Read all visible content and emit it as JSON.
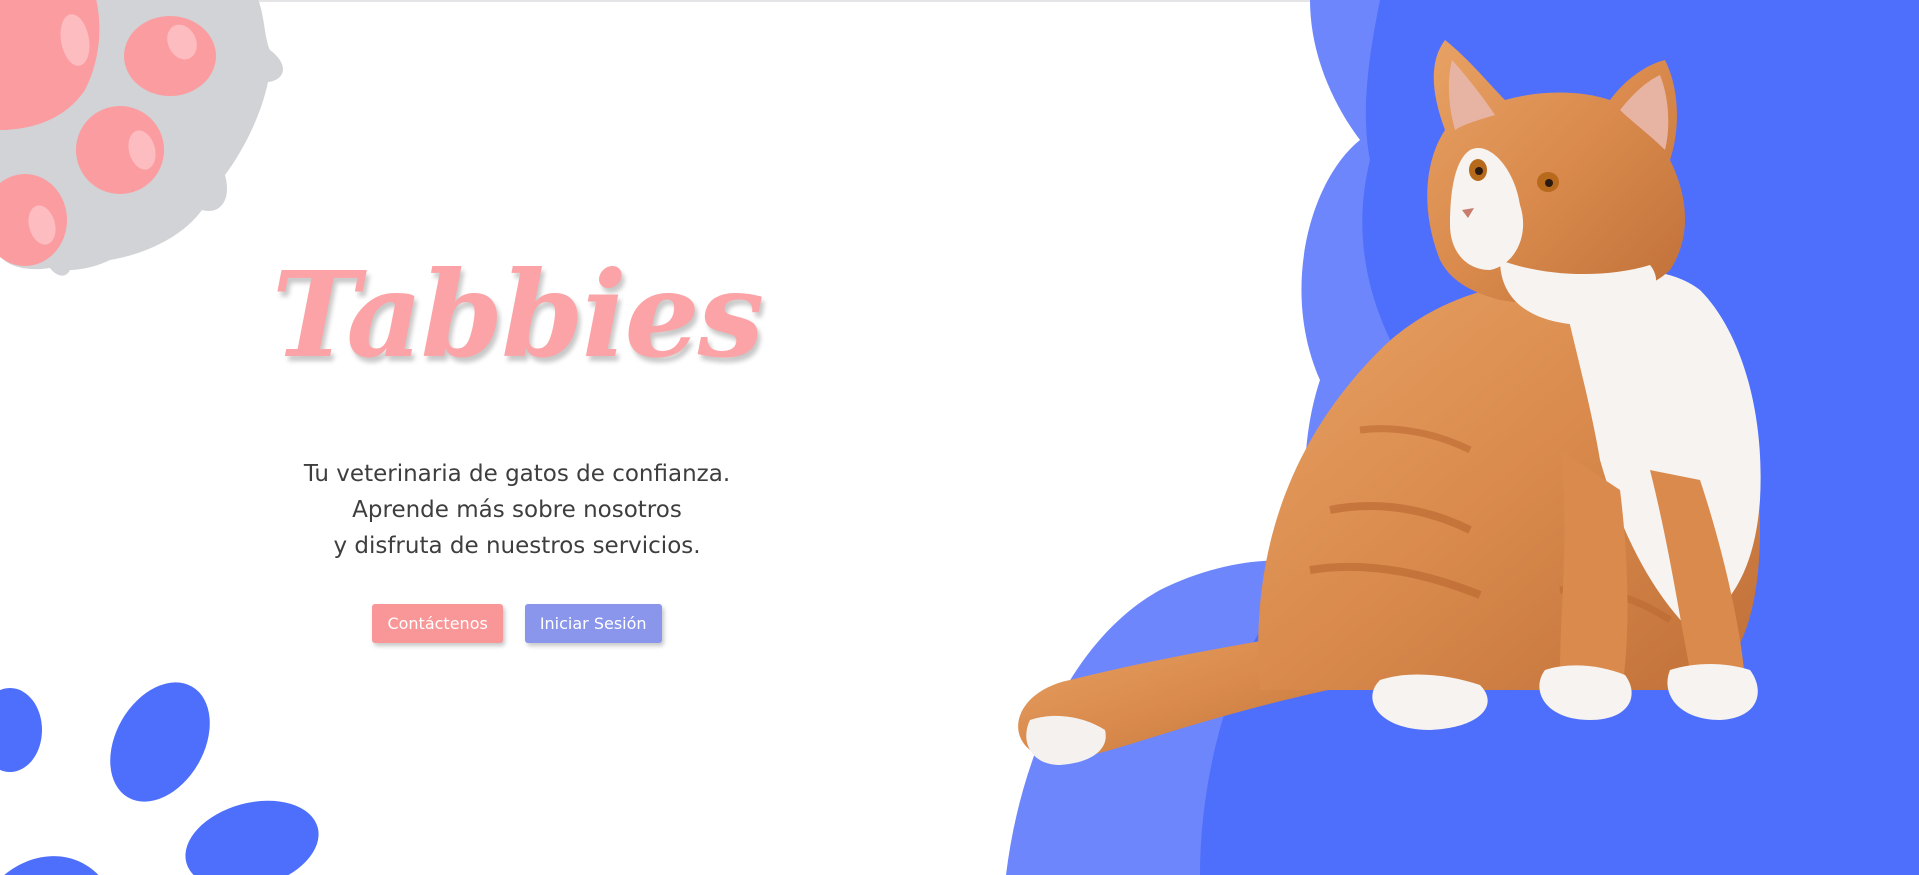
{
  "brand": {
    "title": "Tabbies"
  },
  "hero": {
    "tagline_lines": [
      "Tu veterinaria de gatos de confianza.",
      "Aprende más sobre nosotros",
      "y disfruta de nuestros servicios."
    ]
  },
  "actions": {
    "contact_label": "Contáctenos",
    "login_label": "Iniciar Sesión"
  },
  "icons": {
    "top_left": "paw-print-icon",
    "bottom_left": "paw-print-icon"
  },
  "colors": {
    "brand_pink": "#fba3a6",
    "contact_button": "#f99698",
    "login_button": "#8a96ec",
    "blue": "#4e6ffc",
    "blue_light": "#6d86fc",
    "gray_paw": "#d1d3d6",
    "pink_pad": "#fb9ca0",
    "text": "#3e3e3e"
  }
}
